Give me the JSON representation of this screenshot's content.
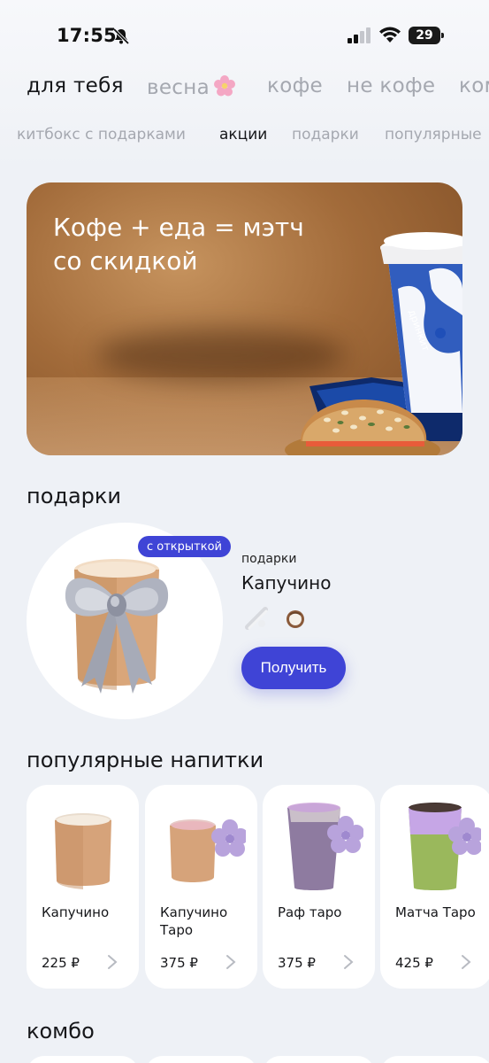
{
  "status_bar": {
    "time": "17:55",
    "battery": "29",
    "icons": [
      "bell-slash-icon",
      "cellular-signal-icon",
      "wifi-icon",
      "battery-icon"
    ]
  },
  "categories": [
    {
      "label": "для тебя",
      "active": true
    },
    {
      "label": "весна",
      "active": false,
      "emoji": "cherry-blossom-icon"
    },
    {
      "label": "кофе",
      "active": false
    },
    {
      "label": "не кофе",
      "active": false
    },
    {
      "label": "ком",
      "active": false
    }
  ],
  "subcategories": [
    {
      "label": "китбокс с подарками",
      "active": false
    },
    {
      "label": "акции",
      "active": true
    },
    {
      "label": "подарки",
      "active": false
    },
    {
      "label": "популярные",
      "active": false
    }
  ],
  "banner": {
    "title_line1": "Кофе + еда = мэтч",
    "title_line2": "со скидкой",
    "cup_brand": "дринкит"
  },
  "gifts": {
    "section_title": "подарки",
    "badge": "с открыткой",
    "category": "подарки",
    "name": "Капучино",
    "ingredients": [
      "milk-icon",
      "coconut-icon"
    ],
    "button_label": "Получить"
  },
  "popular": {
    "section_title": "популярные напитки",
    "items": [
      {
        "name": "Капучино",
        "price": "225 ₽"
      },
      {
        "name": "Капучино Таро",
        "price": "375 ₽"
      },
      {
        "name": "Раф таро",
        "price": "375 ₽"
      },
      {
        "name": "Матча Таро",
        "price": "425 ₽"
      }
    ]
  },
  "combo": {
    "section_title": "комбо"
  },
  "colors": {
    "accent": "#3f44d6",
    "background": "#eef1f6",
    "inactive_text": "#a5a8b0"
  }
}
